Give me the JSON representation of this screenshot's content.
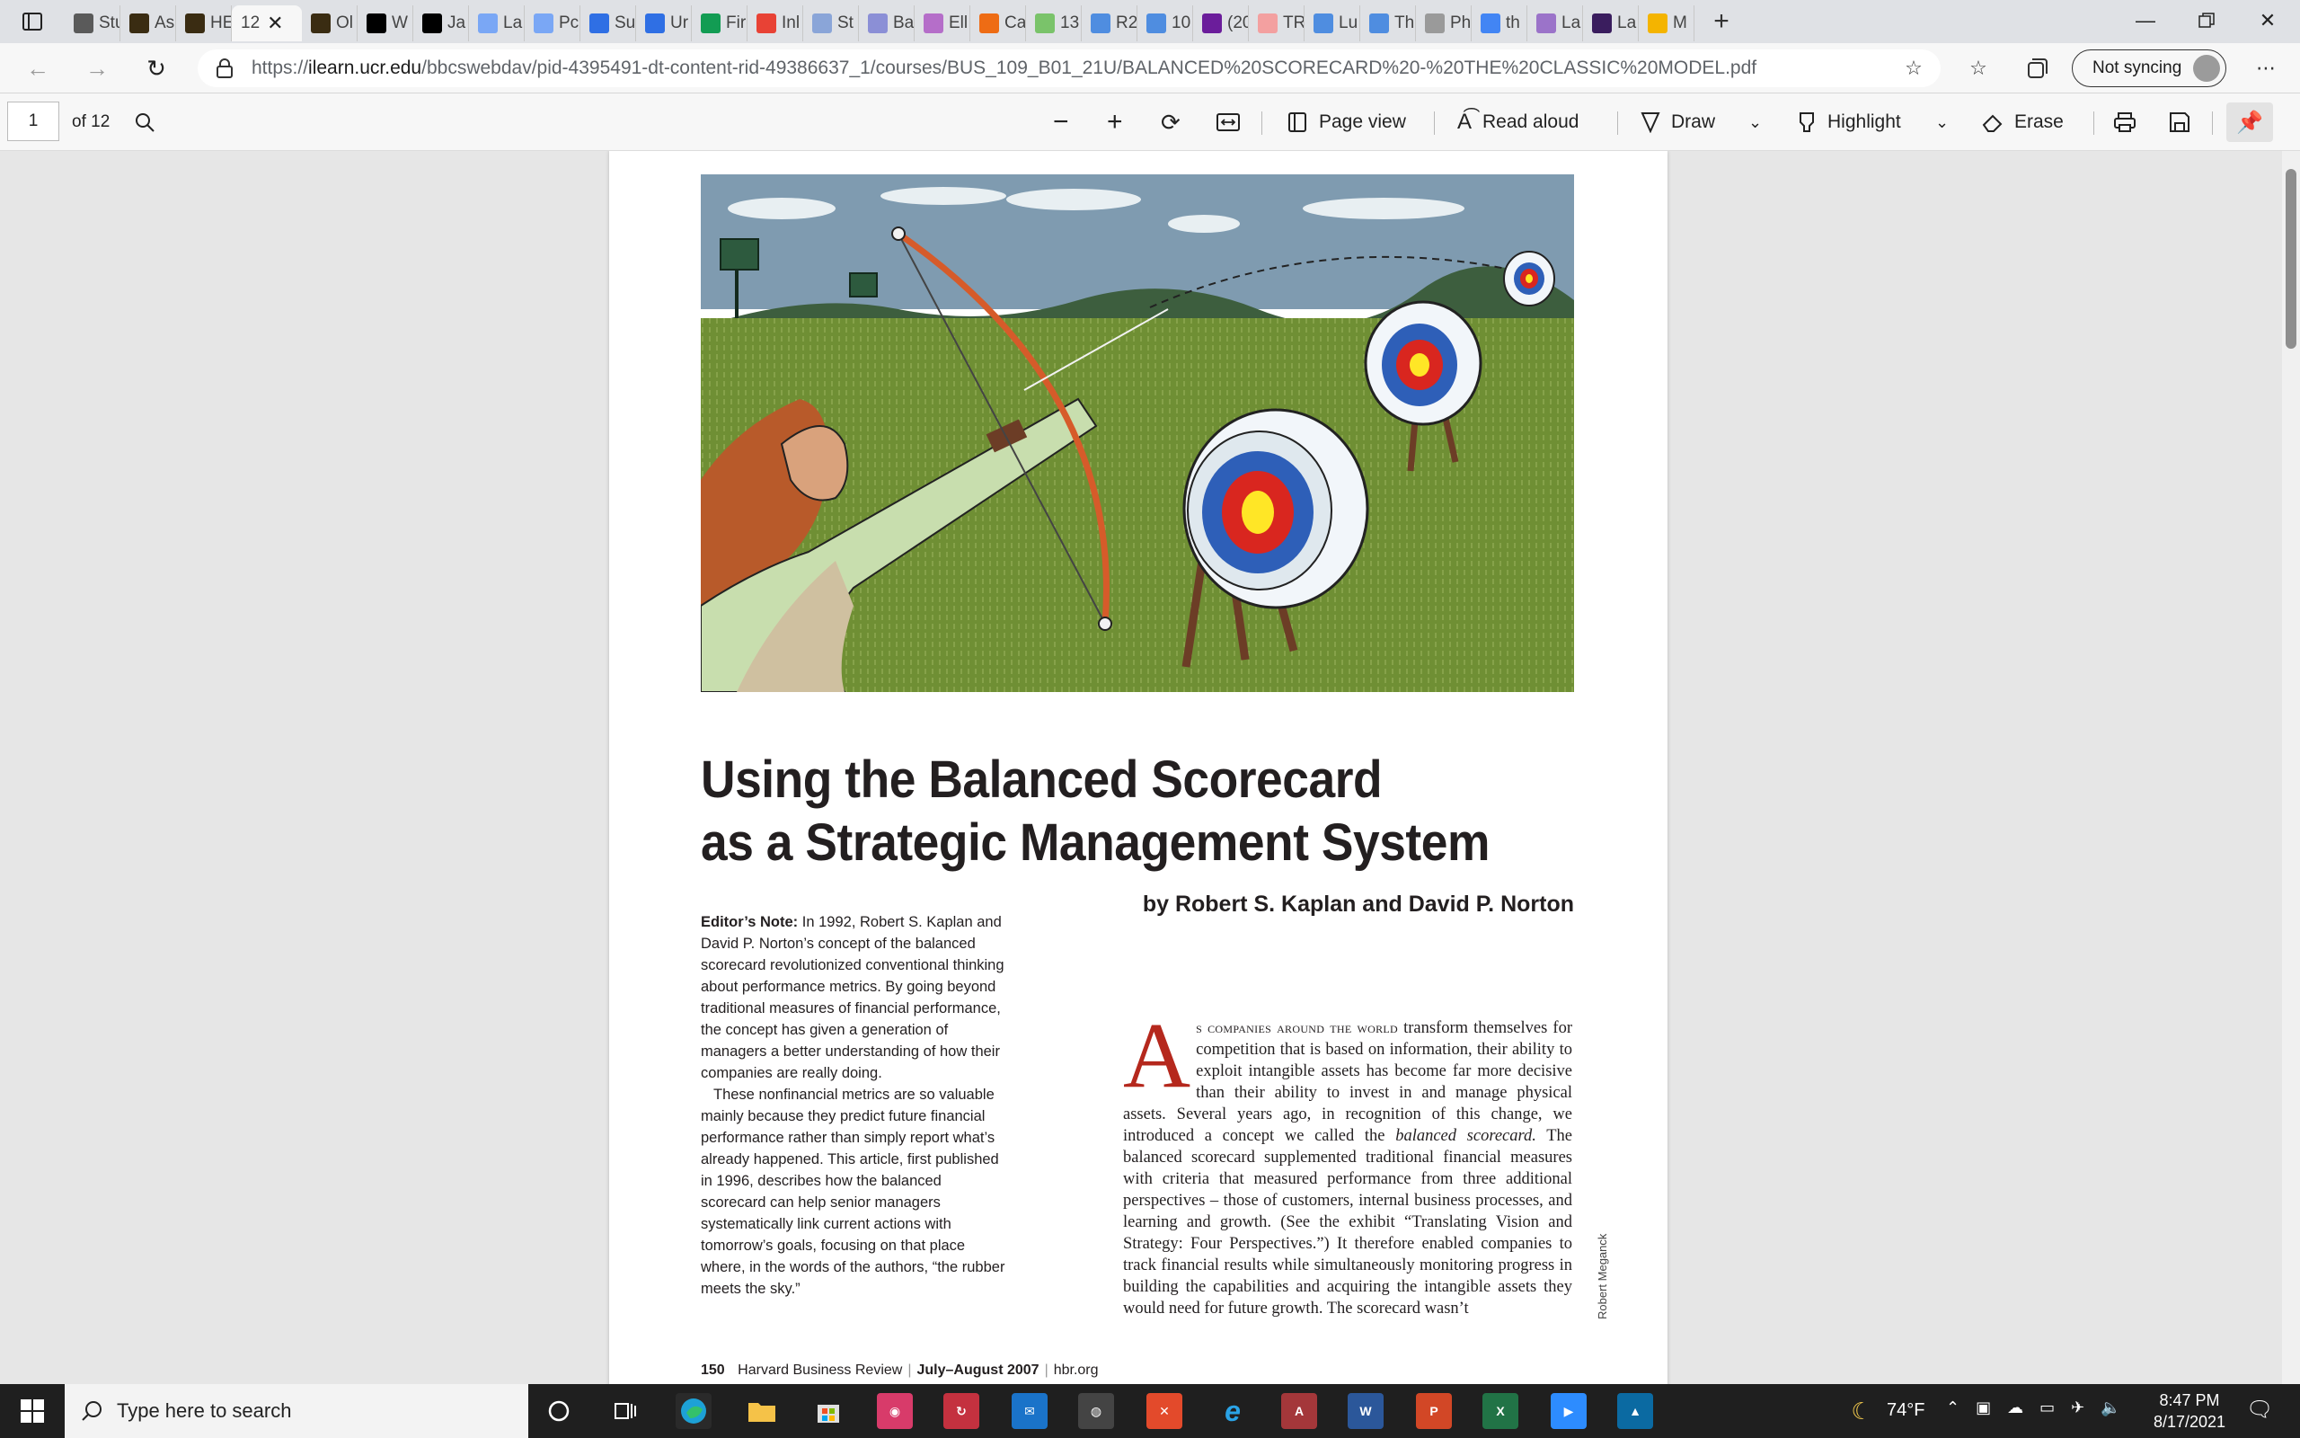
{
  "browser": {
    "tabs": [
      {
        "label": "Stu",
        "icon": "blackboard-icon",
        "color": "#5a5a5a"
      },
      {
        "label": "As",
        "icon": "blackboard-icon",
        "color": "#3a2c12"
      },
      {
        "label": "HE",
        "icon": "blackboard-icon",
        "color": "#3a2c12"
      },
      {
        "label": "12",
        "icon": "pdf-icon",
        "color": "#ffffff",
        "active": true
      },
      {
        "label": "Ol",
        "icon": "blackboard-icon",
        "color": "#3a2c12"
      },
      {
        "label": "W",
        "icon": "blackboard-icon",
        "color": "#000000"
      },
      {
        "label": "Ja",
        "icon": "blackboard-icon",
        "color": "#000000"
      },
      {
        "label": "La",
        "icon": "zoom-icon",
        "color": "#7aa7f5"
      },
      {
        "label": "Pc",
        "icon": "zoom-icon",
        "color": "#7aa7f5"
      },
      {
        "label": "Su",
        "icon": "google-docs-icon",
        "color": "#2f6fe4"
      },
      {
        "label": "Ur",
        "icon": "google-docs-icon",
        "color": "#2f6fe4"
      },
      {
        "label": "Fir",
        "icon": "google-sheets-icon",
        "color": "#129c53"
      },
      {
        "label": "Inl",
        "icon": "gmail-icon",
        "color": "#e84235"
      },
      {
        "label": "St",
        "icon": "r-icon",
        "color": "#8aa5d8"
      },
      {
        "label": "Ba",
        "icon": "circle-icon",
        "color": "#8b8fd6"
      },
      {
        "label": "Ell",
        "icon": "e-icon",
        "color": "#b56ec9"
      },
      {
        "label": "Ca",
        "icon": "chegg-icon",
        "color": "#ee6c14"
      },
      {
        "label": "13",
        "icon": "spinner-icon",
        "color": "#7ac36a"
      },
      {
        "label": "R2",
        "icon": "onedrive-icon",
        "color": "#4f8de0"
      },
      {
        "label": "10",
        "icon": "onedrive-icon",
        "color": "#4f8de0"
      },
      {
        "label": "(20",
        "icon": "mail-icon",
        "color": "#6b1d9b"
      },
      {
        "label": "TR",
        "icon": "bookmark-icon",
        "color": "#f3a0a0"
      },
      {
        "label": "Lu",
        "icon": "onedrive-icon",
        "color": "#4f8de0"
      },
      {
        "label": "Th",
        "icon": "onedrive-icon",
        "color": "#4f8de0"
      },
      {
        "label": "Ph",
        "icon": "globe-icon",
        "color": "#9a9a9a"
      },
      {
        "label": "th",
        "icon": "google-icon",
        "color": "#4285f4"
      },
      {
        "label": "La",
        "icon": "c-icon",
        "color": "#9b73c9"
      },
      {
        "label": "La",
        "icon": "c-icon",
        "color": "#3a1d5e"
      },
      {
        "label": "M",
        "icon": "drive-icon",
        "color": "#f4b400"
      }
    ],
    "url_prefix": "https://",
    "url_host": "ilearn.ucr.edu",
    "url_path": "/bbcswebdav/pid-4395491-dt-content-rid-49386637_1/courses/BUS_109_B01_21U/BALANCED%20SCORECARD%20-%20THE%20CLASSIC%20MODEL.pdf",
    "sync_label": "Not syncing"
  },
  "pdf_toolbar": {
    "page_current": "1",
    "page_total": "of 12",
    "page_view": "Page view",
    "read_aloud": "Read aloud",
    "draw": "Draw",
    "highlight": "Highlight",
    "erase": "Erase"
  },
  "document": {
    "title_line1": "Using the Balanced Scorecard",
    "title_line2": "as a Strategic Management System",
    "byline": "by Robert S. Kaplan and David P. Norton",
    "editor_note_label": "Editor’s Note:",
    "editor_note_p1": "In 1992, Robert S. Kaplan and David P. Norton’s concept of the balanced scorecard revolutionized conventional thinking about performance metrics. By going beyond traditional measures of financial performance, the concept has given a generation of managers a better understanding of how their companies are really doing.",
    "editor_note_p2": "These nonfinancial metrics are so valuable mainly because they predict future financial performance rather than simply report what’s already happened. This article, first published in 1996, describes how the balanced scorecard can help senior managers systematically link current actions with tomorrow’s goals, focusing on that place where, in the words of the authors, “the rubber meets the sky.”",
    "dropcap": "A",
    "lead_smallcaps": "s companies around the world",
    "body_1": " transform themselves for competition that is based on information, their ability to exploit intangible assets has become far more decisive than their ability to invest in and manage physical assets. Several years ago, in recognition of this change, we introduced a concept we called the ",
    "body_em": "balanced scorecard.",
    "body_2": " The balanced scorecard supplemented traditional financial measures with criteria that measured performance from three additional perspectives – those of customers, internal business processes, and learning and growth. (See the exhibit “Translating Vision and Strategy: Four Perspectives.”) It therefore enabled companies to track financial results while simultaneously monitoring progress in building the capabilities and acquiring the intangible assets they would need for future growth. The scorecard wasn’t",
    "credit": "Robert Meganck",
    "footer_page": "150",
    "footer_journal": "Harvard Business Review",
    "footer_issue": "July–August 2007",
    "footer_site": "hbr.org"
  },
  "taskbar": {
    "search_placeholder": "Type here to search",
    "weather": "74°F",
    "time": "8:47 PM",
    "date": "8/17/2021"
  }
}
